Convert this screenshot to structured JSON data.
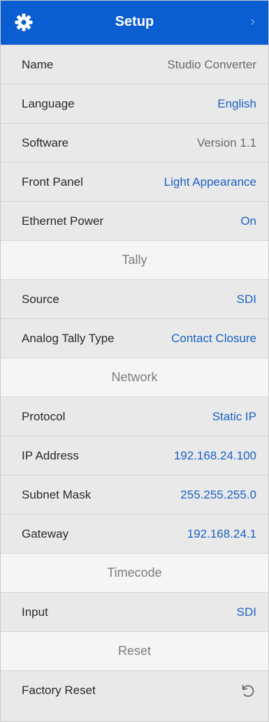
{
  "header": {
    "title": "Setup",
    "icon": "gear-icon",
    "chevron": "›"
  },
  "rows": {
    "name": {
      "label": "Name",
      "value": "Studio Converter"
    },
    "language": {
      "label": "Language",
      "value": "English"
    },
    "software": {
      "label": "Software",
      "value": "Version 1.1"
    },
    "front_panel": {
      "label": "Front Panel",
      "value": "Light Appearance"
    },
    "ethernet_power": {
      "label": "Ethernet Power",
      "value": "On"
    },
    "tally_source": {
      "label": "Source",
      "value": "SDI"
    },
    "analog_tally": {
      "label": "Analog Tally Type",
      "value": "Contact Closure"
    },
    "protocol": {
      "label": "Protocol",
      "value": "Static IP"
    },
    "ip_address": {
      "label": "IP Address",
      "value": "192.168.24.100"
    },
    "subnet_mask": {
      "label": "Subnet Mask",
      "value": "255.255.255.0"
    },
    "gateway": {
      "label": "Gateway",
      "value": "192.168.24.1"
    },
    "timecode_input": {
      "label": "Input",
      "value": "SDI"
    },
    "factory_reset": {
      "label": "Factory Reset",
      "icon": "reset-icon"
    }
  },
  "sections": {
    "tally": "Tally",
    "network": "Network",
    "timecode": "Timecode",
    "reset": "Reset"
  },
  "colors": {
    "header": "#0a5ed1",
    "link": "#1a62c9",
    "row_bg": "#e9e9e9",
    "section_bg": "#f5f5f5"
  }
}
